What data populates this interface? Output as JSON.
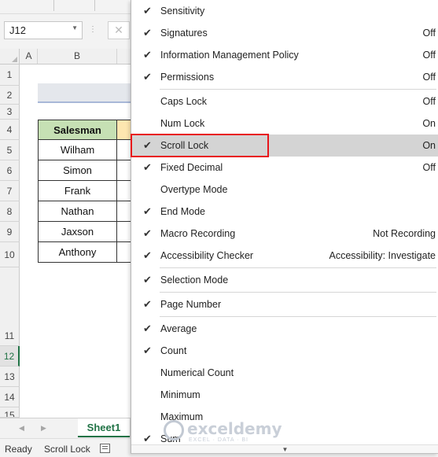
{
  "formula_bar": {
    "name_box": "J12",
    "cancel_symbol": "✕"
  },
  "columns": [
    "A",
    "B"
  ],
  "rows": [
    "1",
    "2",
    "3",
    "4",
    "5",
    "6",
    "7",
    "8",
    "9",
    "10",
    "11",
    "12",
    "13",
    "14",
    "15"
  ],
  "active_row": "12",
  "table": {
    "header": "Salesman",
    "names": [
      "Wilham",
      "Simon",
      "Frank",
      "Nathan",
      "Jaxson",
      "Anthony"
    ]
  },
  "sheet_tab": "Sheet1",
  "status_bar": {
    "ready": "Ready",
    "scroll_lock": "Scroll Lock"
  },
  "context_menu": {
    "items": [
      {
        "label": "Sensitivity",
        "value": "",
        "checked": true
      },
      {
        "label": "Signatures",
        "value": "Off",
        "checked": true
      },
      {
        "label": "Information Management Policy",
        "value": "Off",
        "checked": true
      },
      {
        "label": "Permissions",
        "value": "Off",
        "checked": true
      },
      {
        "label": "Caps Lock",
        "value": "Off",
        "checked": false
      },
      {
        "label": "Num Lock",
        "value": "On",
        "checked": false
      },
      {
        "label": "Scroll Lock",
        "value": "On",
        "checked": true,
        "highlighted": true
      },
      {
        "label": "Fixed Decimal",
        "value": "Off",
        "checked": true
      },
      {
        "label": "Overtype Mode",
        "value": "",
        "checked": false
      },
      {
        "label": "End Mode",
        "value": "",
        "checked": true
      },
      {
        "label": "Macro Recording",
        "value": "Not Recording",
        "checked": true
      },
      {
        "label": "Accessibility Checker",
        "value": "Accessibility: Investigate",
        "checked": true
      },
      {
        "label": "Selection Mode",
        "value": "",
        "checked": true
      },
      {
        "label": "Page Number",
        "value": "",
        "checked": true
      },
      {
        "label": "Average",
        "value": "",
        "checked": true
      },
      {
        "label": "Count",
        "value": "",
        "checked": true
      },
      {
        "label": "Numerical Count",
        "value": "",
        "checked": false
      },
      {
        "label": "Minimum",
        "value": "",
        "checked": false
      },
      {
        "label": "Maximum",
        "value": "",
        "checked": false
      },
      {
        "label": "Sum",
        "value": "",
        "checked": true
      }
    ],
    "checkmark": "✔"
  },
  "watermark": {
    "name": "exceldemy",
    "tagline": "EXCEL · DATA · BI"
  },
  "colors": {
    "accent_green": "#217346",
    "highlight_red": "#e8141a",
    "header_fill": "#c6e0b4"
  }
}
